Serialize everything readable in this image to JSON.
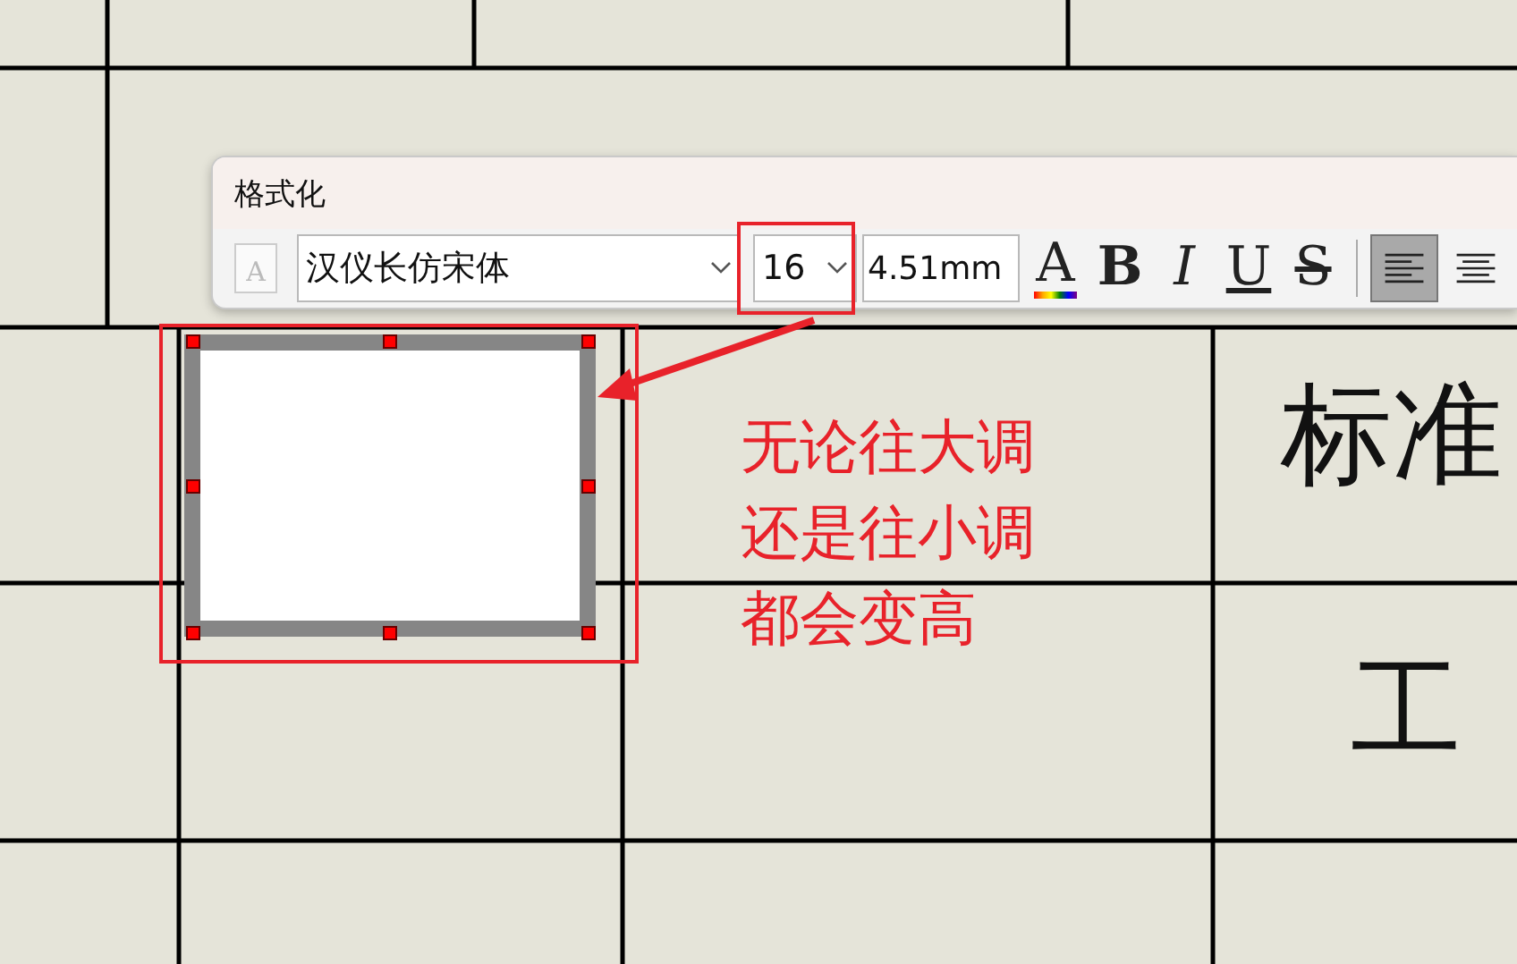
{
  "table": {
    "cells": [
      {
        "text": "标准",
        "kind": "wide"
      },
      {
        "text": "工",
        "kind": "narrow"
      }
    ]
  },
  "selection": {
    "selected": true
  },
  "format_window": {
    "title": "格式化",
    "style_icon": "A",
    "font": {
      "value": "汉仪长仿宋体"
    },
    "size": {
      "value": "16"
    },
    "height_field": {
      "value": "4.51mm"
    },
    "style_buttons": [
      {
        "kind": "color",
        "label": "A"
      },
      {
        "kind": "bold",
        "label": "B"
      },
      {
        "kind": "italic",
        "label": "I"
      },
      {
        "kind": "underline",
        "label": "U"
      },
      {
        "kind": "strike",
        "label": "S"
      }
    ],
    "align": [
      {
        "kind": "left",
        "selected": true
      },
      {
        "kind": "center",
        "selected": false
      }
    ]
  },
  "annotation": {
    "note": [
      "无论往大调",
      "还是往小调",
      "都会变高"
    ]
  }
}
